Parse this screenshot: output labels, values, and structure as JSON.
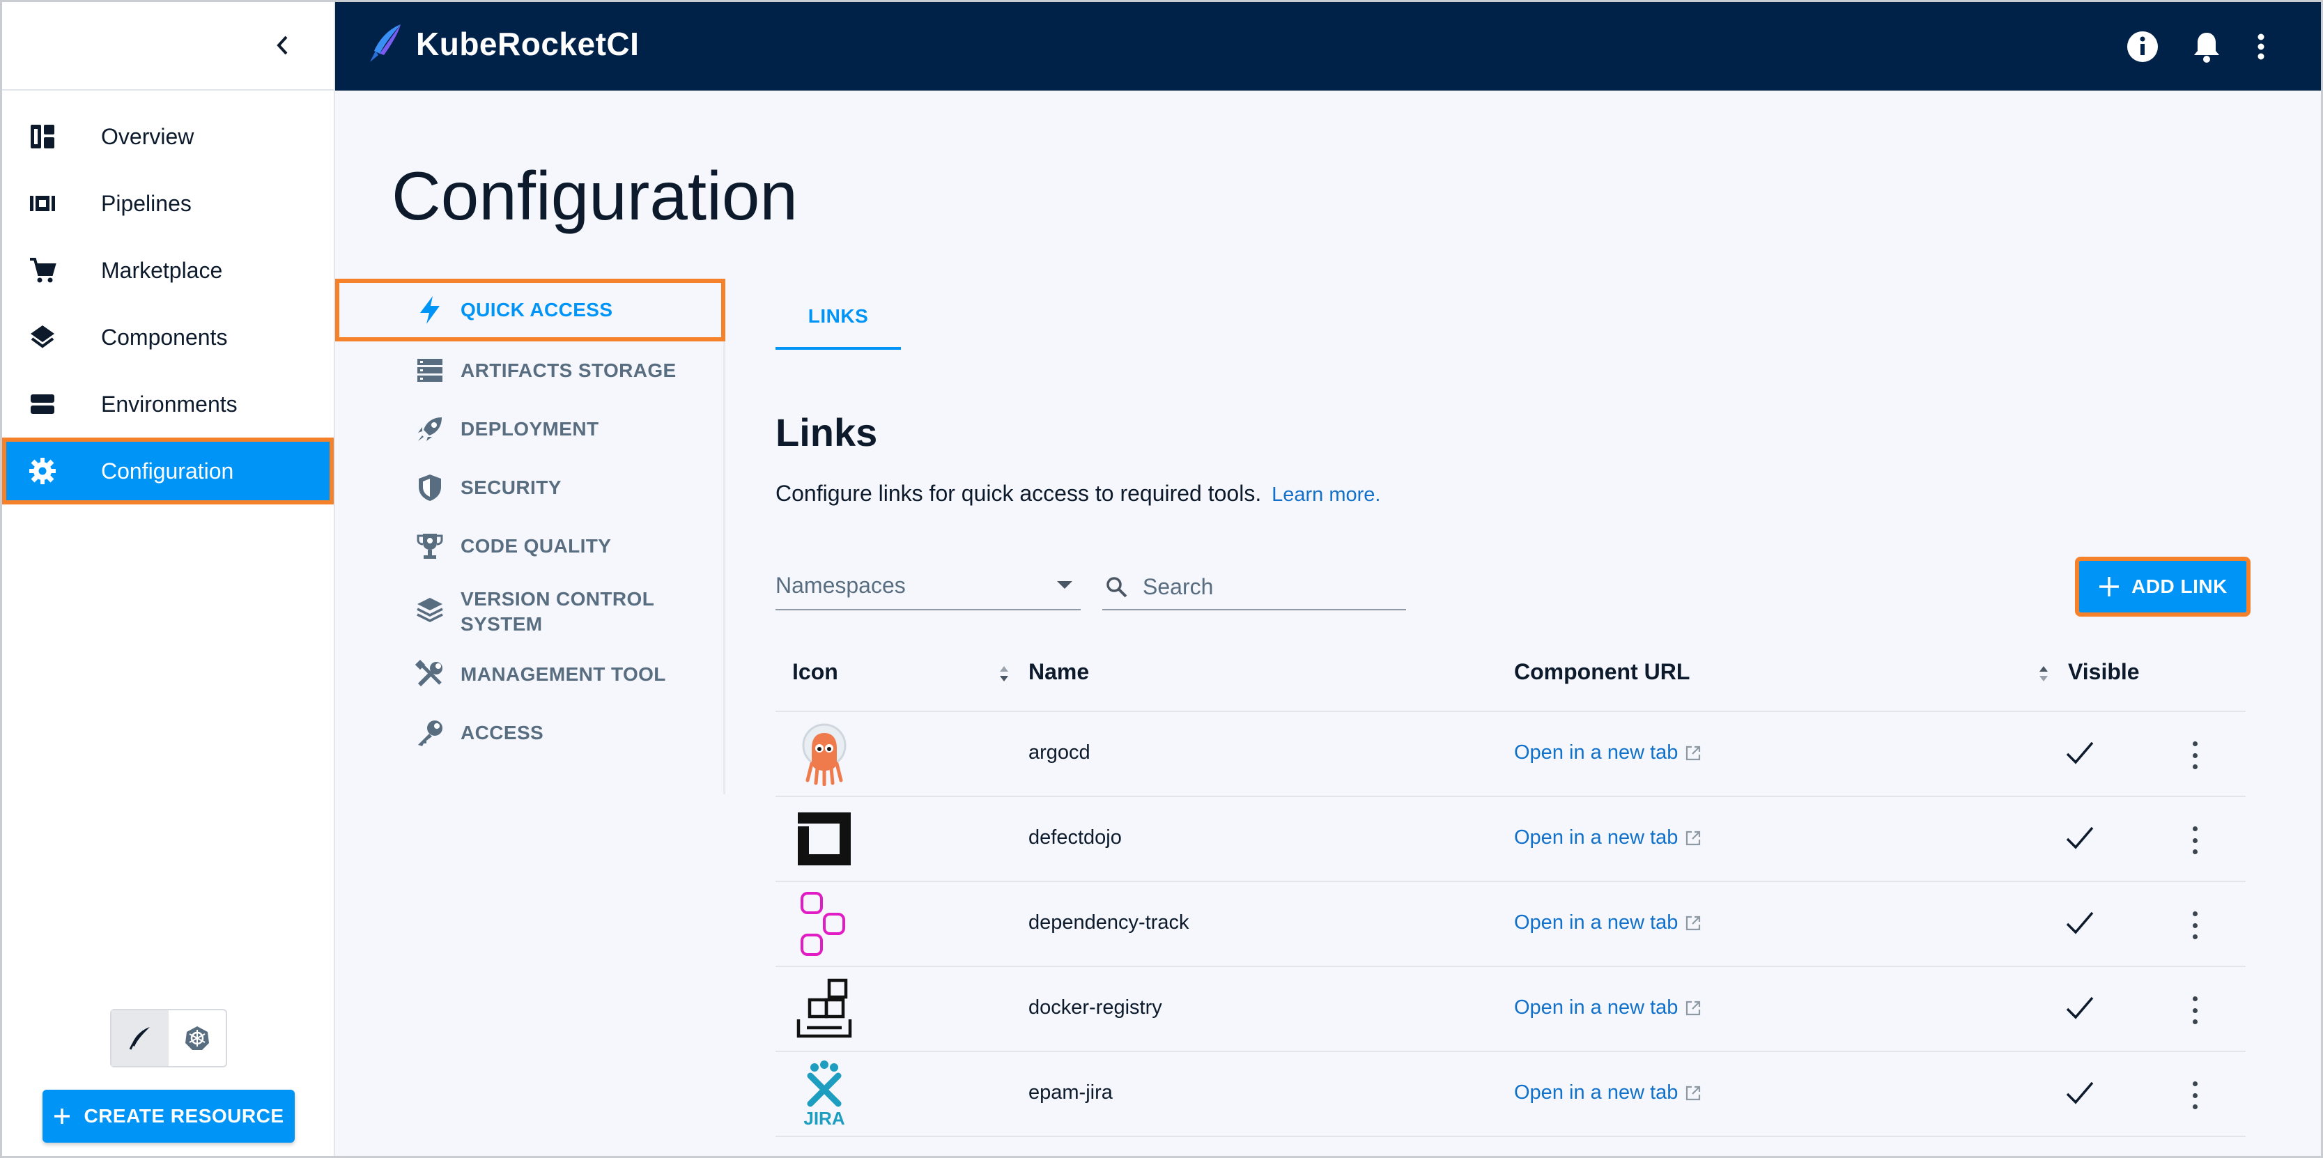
{
  "app": {
    "name": "KubeRocketCI"
  },
  "colors": {
    "header_bg": "#012248",
    "accent": "#0094f7",
    "highlight": "#f5822a",
    "link": "#1170c9"
  },
  "sidebar": {
    "items": [
      {
        "label": "Overview",
        "icon": "dashboard-icon"
      },
      {
        "label": "Pipelines",
        "icon": "pipelines-icon"
      },
      {
        "label": "Marketplace",
        "icon": "cart-icon"
      },
      {
        "label": "Components",
        "icon": "layers-icon"
      },
      {
        "label": "Environments",
        "icon": "environments-icon"
      },
      {
        "label": "Configuration",
        "icon": "gear-icon",
        "active": true
      }
    ],
    "create_label": "CREATE RESOURCE"
  },
  "page": {
    "title": "Configuration"
  },
  "subnav": {
    "items": [
      {
        "label": "QUICK ACCESS",
        "icon": "bolt-icon",
        "active": true
      },
      {
        "label": "ARTIFACTS STORAGE",
        "icon": "storage-icon"
      },
      {
        "label": "DEPLOYMENT",
        "icon": "rocket-icon"
      },
      {
        "label": "SECURITY",
        "icon": "shield-icon"
      },
      {
        "label": "CODE QUALITY",
        "icon": "trophy-icon"
      },
      {
        "label": "VERSION CONTROL",
        "label2": "SYSTEM",
        "icon": "layers-icon"
      },
      {
        "label": "MANAGEMENT TOOL",
        "icon": "tools-icon"
      },
      {
        "label": "ACCESS",
        "icon": "key-icon"
      }
    ]
  },
  "tabs": [
    {
      "label": "LINKS",
      "active": true
    }
  ],
  "links": {
    "title": "Links",
    "description": "Configure links for quick access to required tools.",
    "learn_more": "Learn more.",
    "namespaces_label": "Namespaces",
    "search_placeholder": "Search",
    "add_label": "ADD LINK",
    "columns": {
      "icon": "Icon",
      "name": "Name",
      "url": "Component URL",
      "visible": "Visible"
    },
    "rows": [
      {
        "name": "argocd",
        "url_label": "Open in a new tab",
        "visible": true,
        "icon": "argocd-logo"
      },
      {
        "name": "defectdojo",
        "url_label": "Open in a new tab",
        "visible": true,
        "icon": "defectdojo-logo"
      },
      {
        "name": "dependency-track",
        "url_label": "Open in a new tab",
        "visible": true,
        "icon": "dependency-track-logo"
      },
      {
        "name": "docker-registry",
        "url_label": "Open in a new tab",
        "visible": true,
        "icon": "docker-registry-logo"
      },
      {
        "name": "epam-jira",
        "url_label": "Open in a new tab",
        "visible": true,
        "icon": "jira-logo",
        "logo_text": "JIRA"
      }
    ]
  }
}
